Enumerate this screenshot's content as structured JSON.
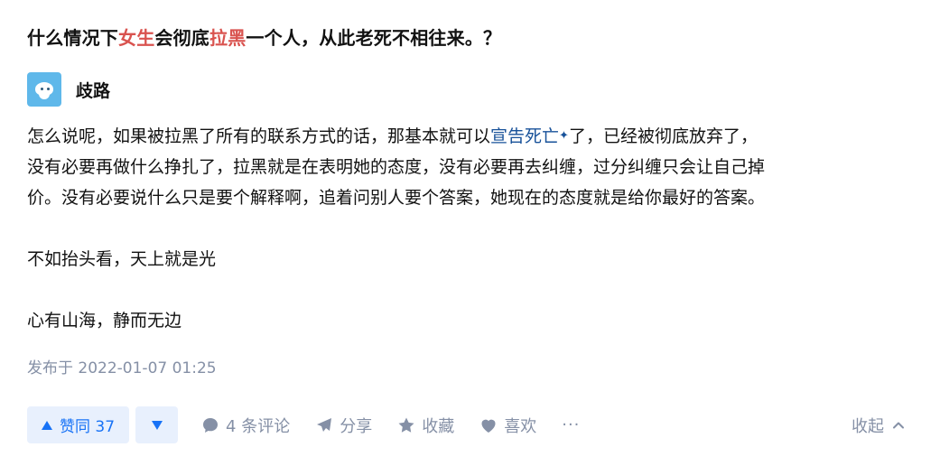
{
  "question": {
    "title_part1": "什么情况下",
    "title_hl1": "女生",
    "title_part2": "会彻底",
    "title_hl2": "拉黑",
    "title_part3": "一个人，从此老死不相往来。？"
  },
  "author": {
    "name": "歧路",
    "avatar_icon": "avatar-image"
  },
  "content": {
    "line1_pre": "怎么说呢，如果被拉黑了所有的联系方式的话，那基本就可以",
    "line1_link": "宣告死亡",
    "line1_spark": "✦",
    "line1_post": "了，已经被彻底放弃了，",
    "line2": "没有必要再做什么挣扎了，拉黑就是在表明她的态度，没有必要再去纠缠，过分纠缠只会让自己掉",
    "line3": "价。没有必要说什么只是要个解释啊，追着问别人要个答案，她现在的态度就是给你最好的答案。",
    "para2": "不如抬头看，天上就是光",
    "para3": "心有山海，静而无边"
  },
  "meta": {
    "published": "发布于 2022-01-07 01:25"
  },
  "actions": {
    "upvote_label": "赞同 37",
    "comments_label": "4 条评论",
    "share_label": "分享",
    "favorite_label": "收藏",
    "like_label": "喜欢",
    "more_label": "···",
    "collapse_label": "收起"
  },
  "colors": {
    "accent": "#1772f6",
    "accent_bg": "#e8f0fd",
    "highlight": "#d9534f",
    "link": "#175199",
    "muted": "#8590a6"
  }
}
